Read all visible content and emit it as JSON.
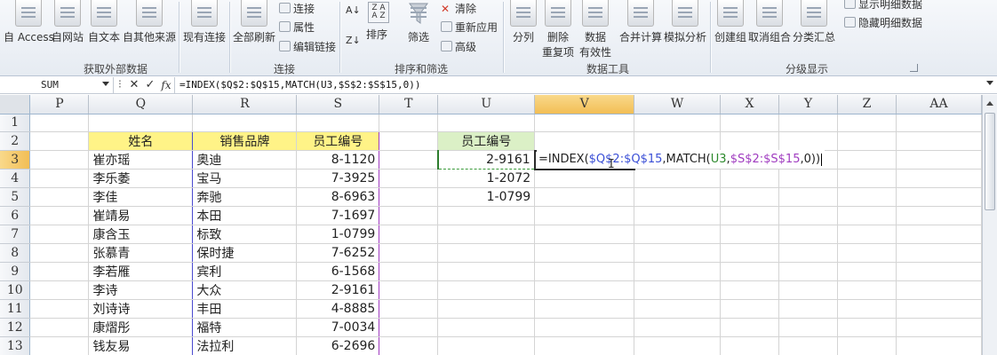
{
  "ribbon": {
    "buttons": [
      {
        "label": "自 Access"
      },
      {
        "label": "自网站"
      },
      {
        "label": "自文本"
      },
      {
        "label": "自其他来源"
      },
      {
        "label": "现有连接"
      },
      {
        "label": "全部刷新"
      }
    ],
    "connections_small": [
      "连接",
      "属性",
      "编辑链接"
    ],
    "sort_label": "排序",
    "filter_label": "筛选",
    "filter_small": [
      "清除",
      "重新应用",
      "高级"
    ],
    "split_label": "分列",
    "remove_dup": [
      "删除",
      "重复项"
    ],
    "validation": [
      "数据",
      "有效性"
    ],
    "consolidate": "合并计算",
    "whatif": "模拟分析",
    "group": "创建组",
    "ungroup": "取消组合",
    "subtotal": "分类汇总",
    "outline_small": [
      "显示明细数据",
      "隐藏明细数据"
    ],
    "groups": {
      "get_external": "获取外部数据",
      "connections": "连接",
      "sort_filter": "排序和筛选",
      "data_tools": "数据工具",
      "outline": "分级显示"
    }
  },
  "formula_bar": {
    "name_box": "SUM",
    "cancel_glyph": "✕",
    "enter_glyph": "✓",
    "fx_glyph": "fx",
    "formula": "=INDEX($Q$2:$Q$15,MATCH(U3,$S$2:$S$15,0))"
  },
  "columns": [
    "P",
    "Q",
    "R",
    "S",
    "T",
    "U",
    "V",
    "W",
    "X",
    "Y",
    "Z",
    "AA"
  ],
  "active_column": "V",
  "active_row": "3",
  "table": {
    "headers": {
      "Q": "姓名",
      "R": "销售品牌",
      "S": "员工编号"
    },
    "rows": [
      {
        "row": "3",
        "Q": "崔亦瑶",
        "R": "奥迪",
        "S": "8-1120"
      },
      {
        "row": "4",
        "Q": "李乐萎",
        "R": "宝马",
        "S": "7-3925"
      },
      {
        "row": "5",
        "Q": "李佳",
        "R": "奔驰",
        "S": "8-6963"
      },
      {
        "row": "6",
        "Q": "崔靖易",
        "R": "本田",
        "S": "7-1697"
      },
      {
        "row": "7",
        "Q": "康含玉",
        "R": "标致",
        "S": "1-0799"
      },
      {
        "row": "8",
        "Q": "张慕青",
        "R": "保时捷",
        "S": "7-6252"
      },
      {
        "row": "9",
        "Q": "李若雁",
        "R": "宾利",
        "S": "6-1568"
      },
      {
        "row": "10",
        "Q": "李诗",
        "R": "大众",
        "S": "2-9161"
      },
      {
        "row": "11",
        "Q": "刘诗诗",
        "R": "丰田",
        "S": "4-8885"
      },
      {
        "row": "12",
        "Q": "康熠彤",
        "R": "福特",
        "S": "7-0034"
      },
      {
        "row": "13",
        "Q": "钱友易",
        "R": "法拉利",
        "S": "6-2696"
      }
    ]
  },
  "lookup": {
    "header": "员工编号",
    "values": [
      "2-9161",
      "1-2072",
      "1-0799"
    ]
  },
  "edit": {
    "eq": "=INDEX(",
    "ref1": "$Q$2:$Q$15",
    "mid": ",MATCH(",
    "ref2": "U3",
    "comma": ",",
    "ref3": "$S$2:$S$15",
    "tail": ",0))"
  },
  "colors": {
    "ref1": "#3a4fd6",
    "ref2": "#2d8a2d",
    "ref3": "#a03cc0",
    "header_yellow": "#fff387",
    "header_green": "#dbf0c6"
  }
}
